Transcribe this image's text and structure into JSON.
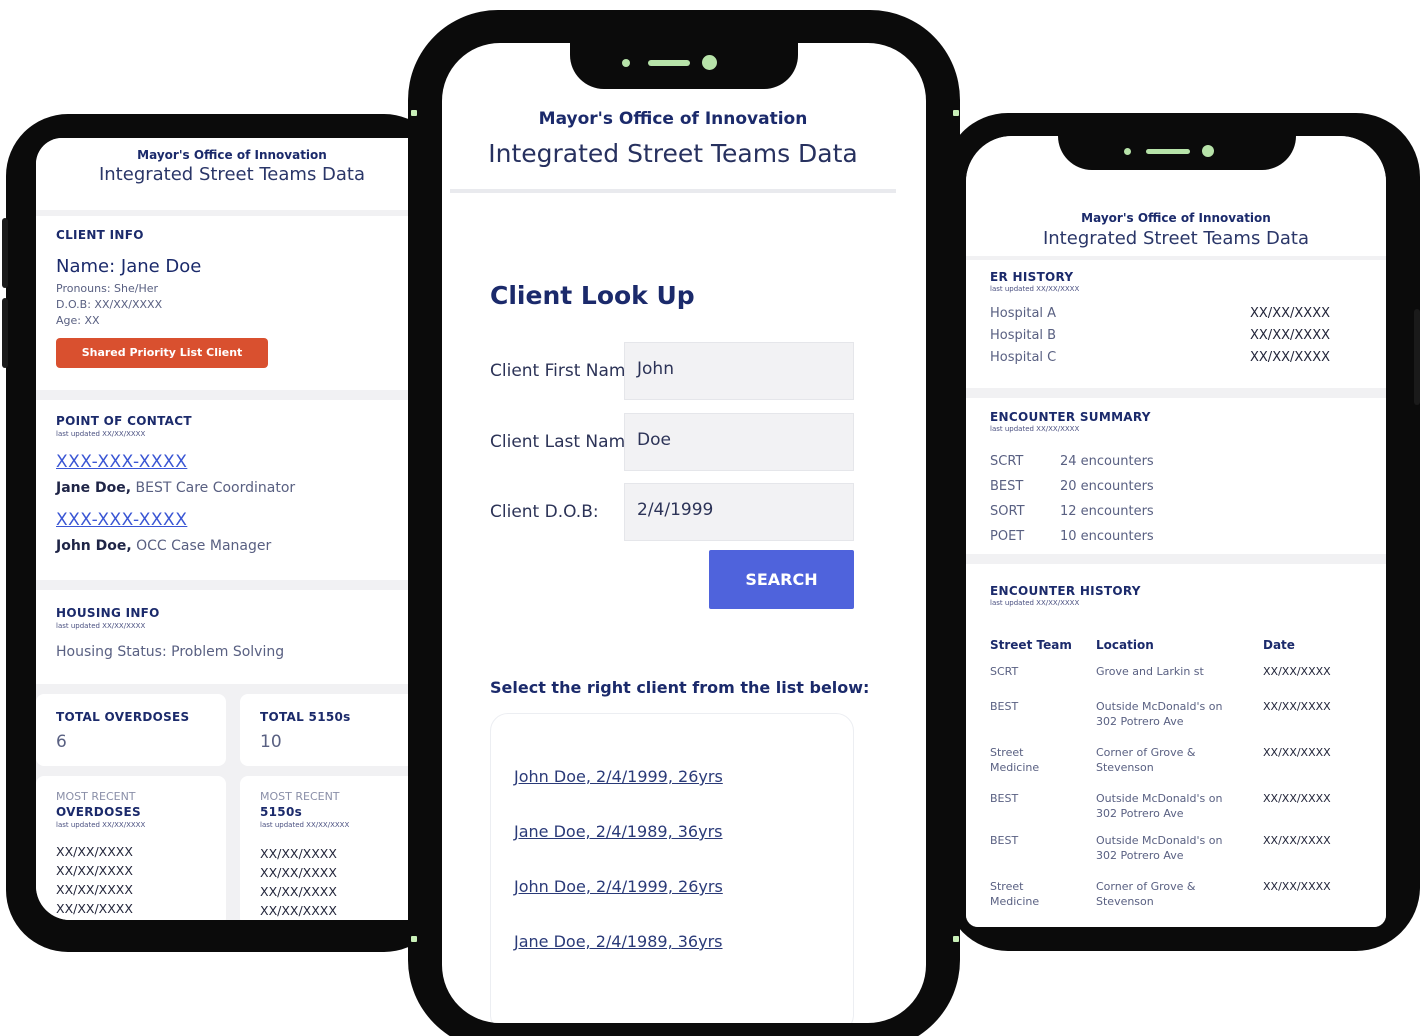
{
  "app": {
    "org": "Mayor's Office of Innovation",
    "title": "Integrated Street Teams Data"
  },
  "left": {
    "client_info": {
      "heading": "CLIENT INFO",
      "name": "Name: Jane Doe",
      "pronouns": "Pronouns: She/Her",
      "dob": "D.O.B: XX/XX/XXXX",
      "age": "Age: XX",
      "badge": "Shared Priority List Client"
    },
    "point_of_contact": {
      "heading": "POINT OF CONTACT",
      "updated": "last updated XX/XX/XXXX",
      "contacts": [
        {
          "phone": "XXX-XXX-XXXX",
          "name": "Jane Doe,",
          "role": " BEST Care Coordinator"
        },
        {
          "phone": "XXX-XXX-XXXX",
          "name": "John Doe,",
          "role": " OCC Case Manager"
        }
      ]
    },
    "housing": {
      "heading": "HOUSING INFO",
      "updated": "last updated XX/XX/XXXX",
      "status": "Housing Status: Problem Solving"
    },
    "totals": [
      {
        "label": "TOTAL OVERDOSES",
        "value": "6"
      },
      {
        "label": "TOTAL 5150s",
        "value": "10"
      }
    ],
    "recent": [
      {
        "pre": "MOST RECENT",
        "label": "OVERDOSES",
        "updated": "last updated XX/XX/XXXX",
        "dates": [
          "XX/XX/XXXX",
          "XX/XX/XXXX",
          "XX/XX/XXXX",
          "XX/XX/XXXX"
        ]
      },
      {
        "pre": "MOST RECENT",
        "label": "5150s",
        "updated": "last updated XX/XX/XXXX",
        "dates": [
          "XX/XX/XXXX",
          "XX/XX/XXXX",
          "XX/XX/XXXX",
          "XX/XX/XXXX"
        ]
      }
    ]
  },
  "center": {
    "lookup_title": "Client Look Up",
    "fields": [
      {
        "label": "Client First Name:",
        "value": "John"
      },
      {
        "label": "Client Last Name:",
        "value": "Doe"
      },
      {
        "label": "Client D.O.B:",
        "value": "2/4/1999"
      }
    ],
    "search_label": "SEARCH",
    "select_label": "Select the right client from the list below:",
    "results": [
      "John Doe, 2/4/1999, 26yrs",
      "Jane Doe, 2/4/1989, 36yrs",
      "John Doe, 2/4/1999, 26yrs",
      "Jane Doe, 2/4/1989, 36yrs"
    ]
  },
  "right": {
    "er_history": {
      "heading": "ER HISTORY",
      "updated": "last updated XX/XX/XXXX",
      "rows": [
        {
          "hospital": "Hospital A",
          "date": "XX/XX/XXXX"
        },
        {
          "hospital": "Hospital B",
          "date": "XX/XX/XXXX"
        },
        {
          "hospital": "Hospital C",
          "date": "XX/XX/XXXX"
        }
      ]
    },
    "encounter_summary": {
      "heading": "ENCOUNTER SUMMARY",
      "updated": "last updated XX/XX/XXXX",
      "rows": [
        {
          "team": "SCRT",
          "count": "24 encounters"
        },
        {
          "team": "BEST",
          "count": "20 encounters"
        },
        {
          "team": "SORT",
          "count": "12 encounters"
        },
        {
          "team": "POET",
          "count": "10 encounters"
        }
      ]
    },
    "encounter_history": {
      "heading": "ENCOUNTER HISTORY",
      "updated": "last updated XX/XX/XXXX",
      "columns": [
        "Street Team",
        "Location",
        "Date"
      ],
      "rows": [
        {
          "team": "SCRT",
          "location": "Grove and Larkin st",
          "date": "XX/XX/XXXX"
        },
        {
          "team": "BEST",
          "location": "Outside McDonald's on 302 Potrero Ave",
          "date": "XX/XX/XXXX"
        },
        {
          "team": "Street Medicine",
          "location": "Corner of Grove & Stevenson",
          "date": "XX/XX/XXXX"
        },
        {
          "team": "BEST",
          "location": "Outside McDonald's on 302 Potrero Ave",
          "date": "XX/XX/XXXX"
        },
        {
          "team": "BEST",
          "location": "Outside McDonald's on 302 Potrero Ave",
          "date": "XX/XX/XXXX"
        },
        {
          "team": "Street Medicine",
          "location": "Corner of Grove & Stevenson",
          "date": "XX/XX/XXXX"
        }
      ]
    }
  },
  "colors": {
    "navy": "#1b2a6b",
    "accent_button": "#4f63dc",
    "badge": "#d9502f",
    "link": "#3a56d4",
    "phone_body": "#0b0b0b",
    "notch_accent": "#b7e3a9"
  },
  "icons": [
    "camera-icon",
    "speaker-icon"
  ]
}
